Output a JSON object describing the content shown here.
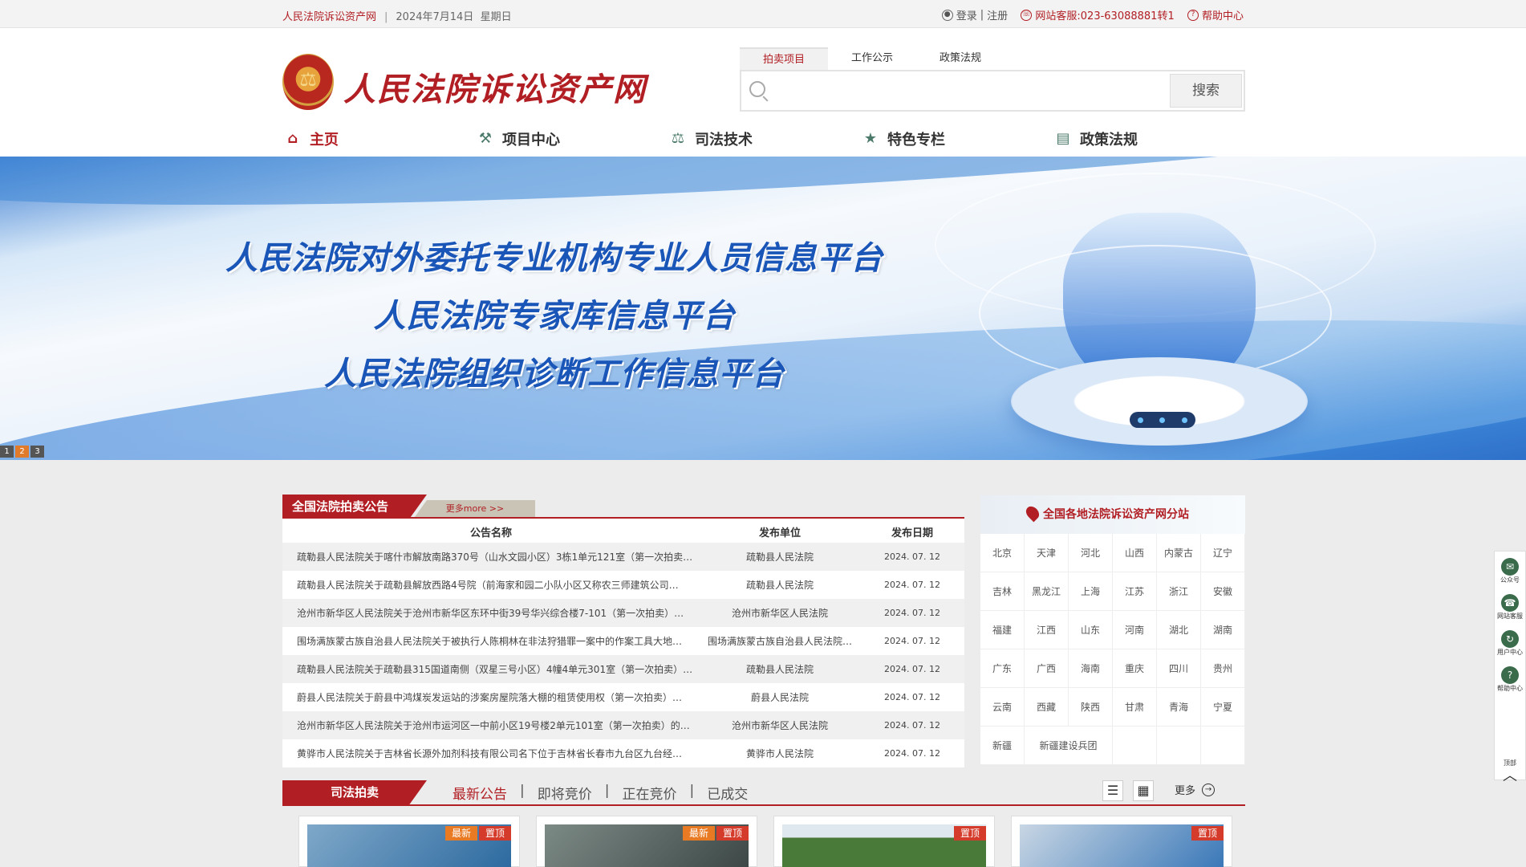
{
  "topbar": {
    "site": "人民法院诉讼资产网",
    "date": "2024年7月14日",
    "weekday": "星期日",
    "login": "登录",
    "divider": "|",
    "register": "注册",
    "service": "网站客服:023-63088881转1",
    "help": "帮助中心"
  },
  "header": {
    "logo_text": "人民法院诉讼资产网",
    "search_tabs": [
      "拍卖项目",
      "工作公示",
      "政策法规"
    ],
    "search_button": "搜索",
    "search_placeholder": ""
  },
  "nav": {
    "items": [
      {
        "label": "主页",
        "icon": "home-icon"
      },
      {
        "label": "项目中心",
        "icon": "gavel-icon"
      },
      {
        "label": "司法技术",
        "icon": "scales-icon"
      },
      {
        "label": "特色专栏",
        "icon": "badge-star-icon"
      },
      {
        "label": "政策法规",
        "icon": "book-icon"
      }
    ]
  },
  "banner": {
    "lines": [
      "人民法院对外委托专业机构专业人员信息平台",
      "人民法院专家库信息平台",
      "人民法院组织诊断工作信息平台"
    ],
    "pages": [
      "1",
      "2",
      "3"
    ],
    "active_page": 2
  },
  "announce": {
    "title": "全国法院拍卖公告",
    "more": "更多more >>",
    "headers": [
      "公告名称",
      "发布单位",
      "发布日期"
    ],
    "rows": [
      {
        "name": "疏勒县人民法院关于喀什市解放南路370号（山水文园小区）3栋1单元121室（第一次拍卖…",
        "unit": "疏勒县人民法院",
        "date": "2024. 07. 12"
      },
      {
        "name": "疏勒县人民法院关于疏勒县解放西路4号院（前海家和园二小队小区又称农三师建筑公司…",
        "unit": "疏勒县人民法院",
        "date": "2024. 07. 12"
      },
      {
        "name": "沧州市新华区人民法院关于沧州市新华区东环中街39号华兴综合楼7-101（第一次拍卖）…",
        "unit": "沧州市新华区人民法院",
        "date": "2024. 07. 12"
      },
      {
        "name": "围场满族蒙古族自治县人民法院关于被执行人陈桐林在非法狩猎罪一案中的作案工具大地…",
        "unit": "围场满族蒙古族自治县人民法院…",
        "date": "2024. 07. 12"
      },
      {
        "name": "疏勒县人民法院关于疏勒县315国道南侧（双星三号小区）4幢4单元301室（第一次拍卖）…",
        "unit": "疏勒县人民法院",
        "date": "2024. 07. 12"
      },
      {
        "name": "蔚县人民法院关于蔚县中鸿煤炭发运站的涉案房屋院落大棚的租赁使用权（第一次拍卖）…",
        "unit": "蔚县人民法院",
        "date": "2024. 07. 12"
      },
      {
        "name": "沧州市新华区人民法院关于沧州市运河区一中前小区19号楼2单元101室（第一次拍卖）的…",
        "unit": "沧州市新华区人民法院",
        "date": "2024. 07. 12"
      },
      {
        "name": "黄骅市人民法院关于吉林省长源外加剂科技有限公司名下位于吉林省长春市九台区九台经…",
        "unit": "黄骅市人民法院",
        "date": "2024. 07. 12"
      }
    ]
  },
  "substations": {
    "title": "全国各地法院诉讼资产网分站",
    "regions": [
      "北京",
      "天津",
      "河北",
      "山西",
      "内蒙古",
      "辽宁",
      "吉林",
      "黑龙江",
      "上海",
      "江苏",
      "浙江",
      "安徽",
      "福建",
      "江西",
      "山东",
      "河南",
      "湖北",
      "湖南",
      "广东",
      "广西",
      "海南",
      "重庆",
      "四川",
      "贵州",
      "云南",
      "西藏",
      "陕西",
      "甘肃",
      "青海",
      "宁夏",
      "新疆"
    ],
    "wide_region": "新疆建设兵团"
  },
  "judicial": {
    "title": "司法拍卖",
    "tabs": [
      "最新公告",
      "即将竞价",
      "正在竞价",
      "已成交"
    ],
    "separator": "|",
    "more": "更多"
  },
  "cards": [
    {
      "badges": [
        "最新",
        "置顶"
      ]
    },
    {
      "badges": [
        "最新",
        "置顶"
      ]
    },
    {
      "badges": [
        "置顶"
      ]
    },
    {
      "badges": [
        "置顶"
      ]
    }
  ],
  "sidebar": {
    "items": [
      "公众号",
      "网站客服",
      "用户中心",
      "帮助中心"
    ],
    "top": "顶部"
  },
  "colors": {
    "brand_red": "#b11e23",
    "banner_blue": "#1a55b8",
    "badge_orange": "#e87a24",
    "badge_red": "#d43b2a"
  }
}
